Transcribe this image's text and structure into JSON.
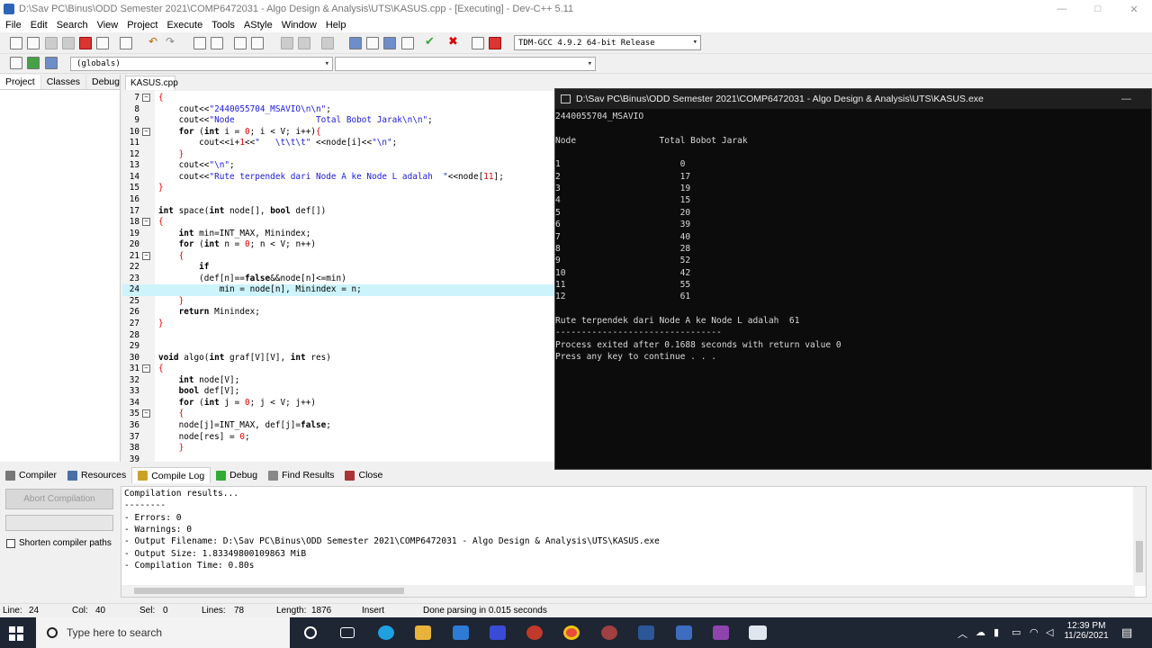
{
  "window": {
    "title": "D:\\Sav PC\\Binus\\ODD Semester 2021\\COMP6472031 - Algo Design & Analysis\\UTS\\KASUS.cpp - [Executing] - Dev-C++ 5.11",
    "min": "—",
    "max": "□",
    "close": "✕"
  },
  "menu": [
    "File",
    "Edit",
    "Search",
    "View",
    "Project",
    "Execute",
    "Tools",
    "AStyle",
    "Window",
    "Help"
  ],
  "toolbar": {
    "compiler": "TDM-GCC 4.9.2 64-bit Release",
    "scope": "(globals)",
    "member": ""
  },
  "left_tabs": [
    "Project",
    "Classes",
    "Debug"
  ],
  "editor_tab": "KASUS.cpp",
  "editor_lines": [
    {
      "n": "7",
      "fold": "⊟",
      "html": "<span class='p'>{</span>"
    },
    {
      "n": "8",
      "fold": "",
      "html": "    cout&lt;&lt;<span class='s'>\"2440055704_MSAVIO\\n\\n\"</span>;"
    },
    {
      "n": "9",
      "fold": "",
      "html": "    cout&lt;&lt;<span class='s'>\"Node                Total Bobot Jarak\\n\\n\"</span>;"
    },
    {
      "n": "10",
      "fold": "⊟",
      "html": "    <span class='k'>for</span> (<span class='k'>int</span> i = <span class='p'>0</span>; i &lt; V; i++)<span class='p'>{</span>"
    },
    {
      "n": "11",
      "fold": "",
      "html": "        cout&lt;&lt;i+<span class='p'>1</span>&lt;&lt;<span class='s'>\"   \\t\\t\\t\"</span> &lt;&lt;node[i]&lt;&lt;<span class='s'>\"\\n\"</span>;"
    },
    {
      "n": "12",
      "fold": "",
      "html": "    <span class='p'>}</span>"
    },
    {
      "n": "13",
      "fold": "",
      "html": "    cout&lt;&lt;<span class='s'>\"\\n\"</span>;"
    },
    {
      "n": "14",
      "fold": "",
      "html": "    cout&lt;&lt;<span class='s'>\"Rute terpendek dari Node A ke Node L adalah  \"</span>&lt;&lt;node[<span class='p'>11</span>];"
    },
    {
      "n": "15",
      "fold": "",
      "html": "<span class='p'>}</span>"
    },
    {
      "n": "16",
      "fold": "",
      "html": ""
    },
    {
      "n": "17",
      "fold": "",
      "html": "<span class='k'>int</span> space(<span class='k'>int</span> node[], <span class='k'>bool</span> def[])"
    },
    {
      "n": "18",
      "fold": "⊟",
      "html": "<span class='p'>{</span>"
    },
    {
      "n": "19",
      "fold": "",
      "html": "    <span class='k'>int</span> min=INT_MAX, Minindex;"
    },
    {
      "n": "20",
      "fold": "",
      "html": "    <span class='k'>for</span> (<span class='k'>int</span> n = <span class='p'>0</span>; n &lt; V; n++)"
    },
    {
      "n": "21",
      "fold": "⊟",
      "html": "    <span class='p'>{</span>"
    },
    {
      "n": "22",
      "fold": "",
      "html": "        <span class='k'>if</span>"
    },
    {
      "n": "23",
      "fold": "",
      "html": "        (def[n]==<span class='k'>false</span>&amp;&amp;node[n]&lt;=min)"
    },
    {
      "n": "24",
      "fold": "",
      "html": "            min = node[n], Minindex = n;",
      "hl": true
    },
    {
      "n": "25",
      "fold": "",
      "html": "    <span class='p'>}</span>"
    },
    {
      "n": "26",
      "fold": "",
      "html": "    <span class='k'>return</span> Minindex;"
    },
    {
      "n": "27",
      "fold": "",
      "html": "<span class='p'>}</span>"
    },
    {
      "n": "28",
      "fold": "",
      "html": ""
    },
    {
      "n": "29",
      "fold": "",
      "html": ""
    },
    {
      "n": "30",
      "fold": "",
      "html": "<span class='k'>void</span> algo(<span class='k'>int</span> graf[V][V], <span class='k'>int</span> res)"
    },
    {
      "n": "31",
      "fold": "⊟",
      "html": "<span class='p'>{</span>"
    },
    {
      "n": "32",
      "fold": "",
      "html": "    <span class='k'>int</span> node[V];"
    },
    {
      "n": "33",
      "fold": "",
      "html": "    <span class='k'>bool</span> def[V];"
    },
    {
      "n": "34",
      "fold": "",
      "html": "    <span class='k'>for</span> (<span class='k'>int</span> j = <span class='p'>0</span>; j &lt; V; j++)"
    },
    {
      "n": "35",
      "fold": "⊟",
      "html": "    <span class='p'>{</span>"
    },
    {
      "n": "36",
      "fold": "",
      "html": "    node[j]=INT_MAX, def[j]=<span class='k'>false</span>;"
    },
    {
      "n": "37",
      "fold": "",
      "html": "    node[res] = <span class='p'>0</span>;"
    },
    {
      "n": "38",
      "fold": "",
      "html": "    <span class='p'>}</span>"
    },
    {
      "n": "39",
      "fold": "",
      "html": ""
    }
  ],
  "console": {
    "title": "D:\\Sav PC\\Binus\\ODD Semester 2021\\COMP6472031 - Algo Design & Analysis\\UTS\\KASUS.exe",
    "lines": [
      "2440055704_MSAVIO",
      "",
      "Node                Total Bobot Jarak",
      "",
      "1                       0",
      "2                       17",
      "3                       19",
      "4                       15",
      "5                       20",
      "6                       39",
      "7                       40",
      "8                       28",
      "9                       52",
      "10                      42",
      "11                      55",
      "12                      61",
      "",
      "Rute terpendek dari Node A ke Node L adalah  61",
      "--------------------------------",
      "Process exited after 0.1688 seconds with return value 0",
      "Press any key to continue . . ."
    ]
  },
  "bottom_tabs": [
    "Compiler",
    "Resources",
    "Compile Log",
    "Debug",
    "Find Results",
    "Close"
  ],
  "bottom": {
    "abort": "Abort Compilation",
    "shorten": "Shorten compiler paths",
    "log": [
      "Compilation results...",
      "--------",
      "- Errors: 0",
      "- Warnings: 0",
      "- Output Filename: D:\\Sav PC\\Binus\\ODD Semester 2021\\COMP6472031 - Algo Design & Analysis\\UTS\\KASUS.exe",
      "- Output Size: 1.83349800109863 MiB",
      "- Compilation Time: 0.80s"
    ]
  },
  "status": {
    "line_label": "Line:",
    "line": "24",
    "col_label": "Col:",
    "col": "40",
    "sel_label": "Sel:",
    "sel": "0",
    "lines_label": "Lines:",
    "lines": "78",
    "length_label": "Length:",
    "length": "1876",
    "mode": "Insert",
    "message": "Done parsing in 0.015 seconds"
  },
  "taskbar": {
    "search_placeholder": "Type here to search",
    "time": "12:39 PM",
    "date": "11/26/2021"
  }
}
